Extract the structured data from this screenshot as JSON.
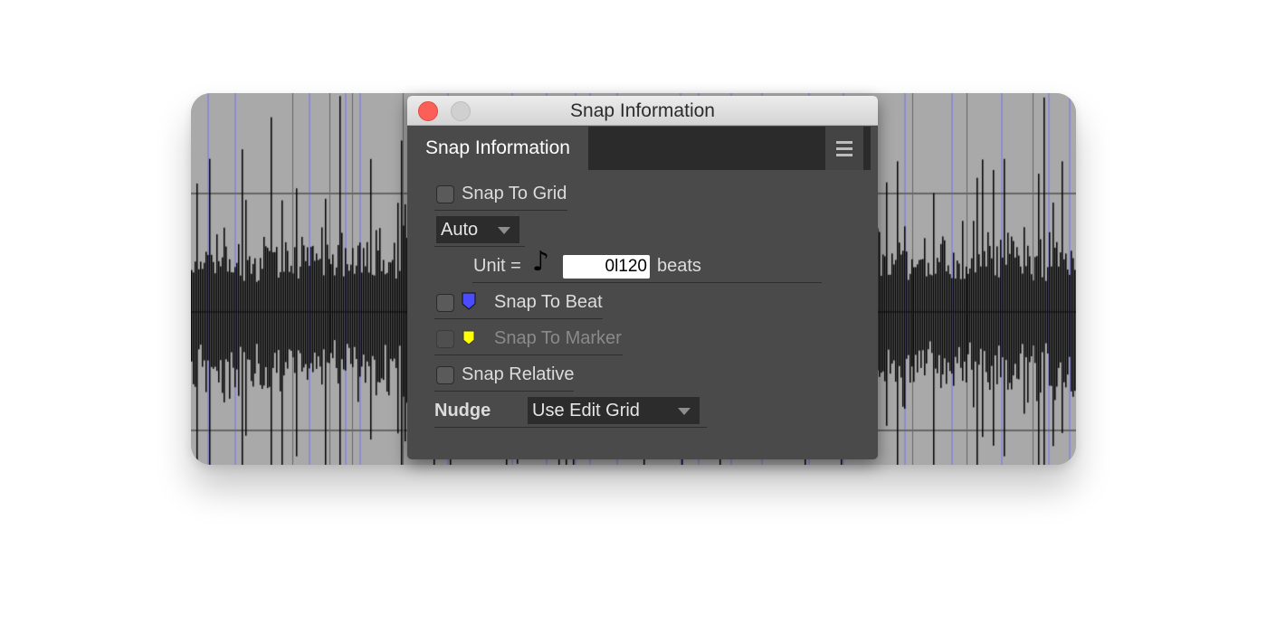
{
  "window": {
    "title": "Snap Information"
  },
  "tab": {
    "label": "Snap Information"
  },
  "snap_to_grid": {
    "label": "Snap To Grid",
    "checked": false
  },
  "grid_mode": {
    "value": "Auto"
  },
  "unit": {
    "label": "Unit =",
    "note_icon": "eighth-note-icon",
    "value": "0l120",
    "suffix": "beats"
  },
  "snap_to_beat": {
    "label": "Snap To Beat",
    "checked": false,
    "marker_color": "#4b4bff"
  },
  "snap_to_marker": {
    "label": "Snap To Marker",
    "checked": false,
    "disabled": true,
    "marker_color": "#ffff00"
  },
  "snap_relative": {
    "label": "Snap Relative",
    "checked": false
  },
  "nudge": {
    "label": "Nudge",
    "value": "Use Edit Grid"
  },
  "colors": {
    "panel": "#4a4a4a",
    "waveform": "#000000",
    "waveform_bg": "#a9a9a9",
    "beat_line": "#8d8dd0",
    "close_button": "#fc5f57"
  }
}
